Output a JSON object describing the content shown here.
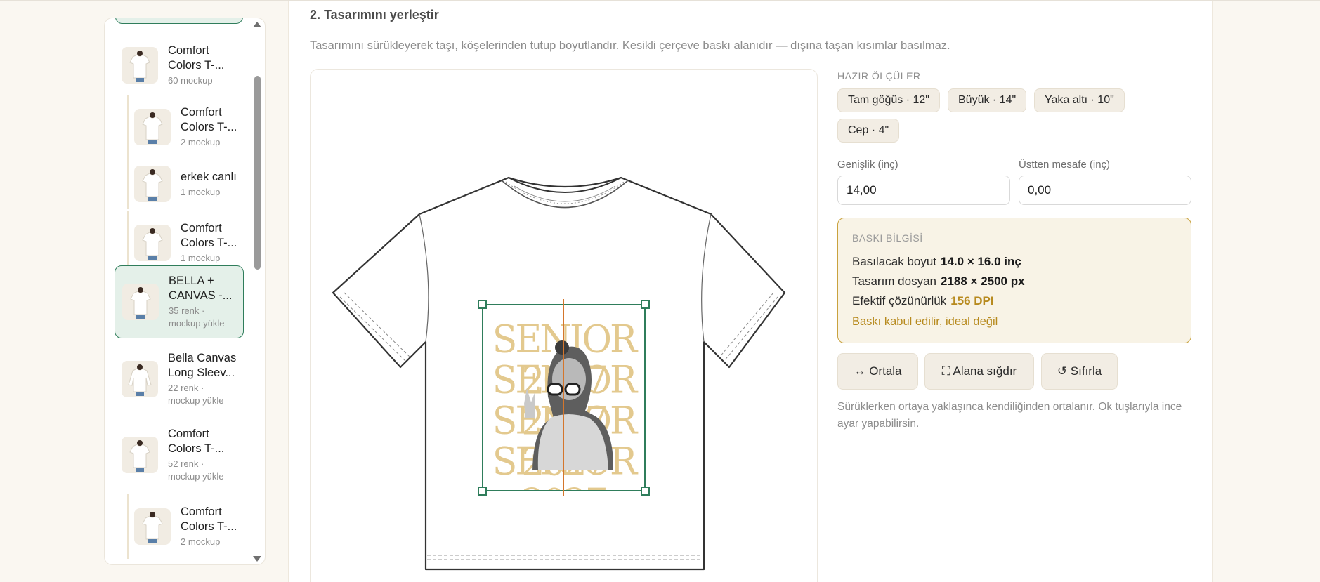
{
  "sidebar": {
    "items": [
      {
        "name_line1": "Comfort",
        "name_line2": "Colors T-...",
        "sub_line1": "60 mockup",
        "sub_line2": ""
      },
      {
        "name_line1": "Comfort",
        "name_line2": "Colors T-...",
        "sub_line1": "2 mockup",
        "sub_line2": ""
      },
      {
        "name_line1": "erkek canlı",
        "name_line2": "",
        "sub_line1": "1 mockup",
        "sub_line2": ""
      },
      {
        "name_line1": "Comfort",
        "name_line2": "Colors T-...",
        "sub_line1": "1 mockup",
        "sub_line2": ""
      },
      {
        "name_line1": "BELLA +",
        "name_line2": "CANVAS -...",
        "sub_line1": "35 renk ·",
        "sub_line2": "mockup yükle"
      },
      {
        "name_line1": "Bella Canvas",
        "name_line2": "Long Sleev...",
        "sub_line1": "22 renk ·",
        "sub_line2": "mockup yükle"
      },
      {
        "name_line1": "Comfort",
        "name_line2": "Colors T-...",
        "sub_line1": "52 renk ·",
        "sub_line2": "mockup yükle"
      },
      {
        "name_line1": "Comfort",
        "name_line2": "Colors T-...",
        "sub_line1": "2 mockup",
        "sub_line2": ""
      }
    ]
  },
  "main": {
    "title": "2. Tasarımını yerleştir",
    "description": "Tasarımını sürükleyerek taşı, köşelerinden tutup boyutlandır. Kesikli çerçeve baskı alanıdır — dışına taşan kısımlar basılmaz.",
    "design_text": [
      "SENIOR 2027",
      "SENIOR 2027",
      "SENIOR 2027",
      "SENIOR 2027"
    ]
  },
  "presets": {
    "label": "HAZIR ÖLÇÜLER",
    "items": [
      "Tam göğüs · 12\"",
      "Büyük · 14\"",
      "Yaka altı · 10\"",
      "Cep · 4\""
    ]
  },
  "fields": {
    "width_label": "Genişlik (inç)",
    "width_value": "14,00",
    "top_label": "Üstten mesafe (inç)",
    "top_value": "0,00"
  },
  "print_info": {
    "title": "BASKI BİLGİSİ",
    "size_label": "Basılacak boyut",
    "size_value": "14.0 × 16.0 inç",
    "file_label": "Tasarım dosyan",
    "file_value": "2188 × 2500 px",
    "res_label": "Efektif çözünürlük",
    "res_value": "156 DPI",
    "note": "Baskı kabul edilir, ideal değil"
  },
  "actions": {
    "center": "↔ Ortala",
    "fit": "⛶ Alana sığdır",
    "reset": "↺ Sıfırla"
  },
  "hint": "Sürüklerken ortaya yaklaşınca kendiliğinden ortalanır. Ok tuşlarıyla ince ayar yapabilirsin.",
  "colors": {
    "accent_green": "#2f7d5b",
    "gold": "#b78a1e",
    "guide_orange": "#d4762c"
  }
}
